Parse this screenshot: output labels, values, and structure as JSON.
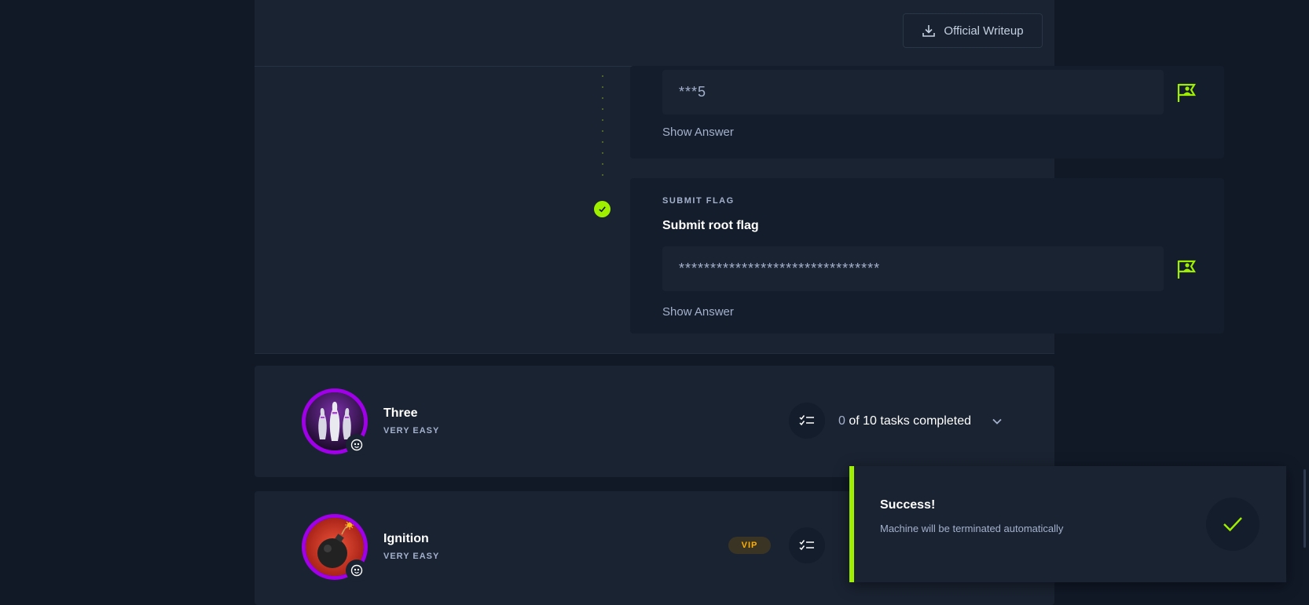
{
  "header": {
    "writeup_label": "Official Writeup"
  },
  "questions": [
    {
      "answer_masked": "***5",
      "show_answer_label": "Show Answer"
    },
    {
      "type_label": "SUBMIT FLAG",
      "title": "Submit root flag",
      "answer_masked": "********************************",
      "show_answer_label": "Show Answer"
    }
  ],
  "machines": [
    {
      "name": "Three",
      "difficulty": "VERY EASY",
      "tasks_done": "0",
      "tasks_text": " of 10 tasks completed"
    },
    {
      "name": "Ignition",
      "difficulty": "VERY EASY",
      "badge": "VIP"
    }
  ],
  "toast": {
    "title": "Success!",
    "message": "Machine will be terminated automatically"
  },
  "colors": {
    "accent": "#9fef00",
    "page_bg": "#111927",
    "panel_bg": "#1a2332",
    "card_bg": "#141d2b",
    "avatar_ring": "#a000e8",
    "vip": "#ffaf00"
  },
  "icons": [
    "download-icon",
    "flag-user-icon",
    "check-icon",
    "task-list-icon",
    "chevron-down-icon",
    "linux-icon"
  ]
}
